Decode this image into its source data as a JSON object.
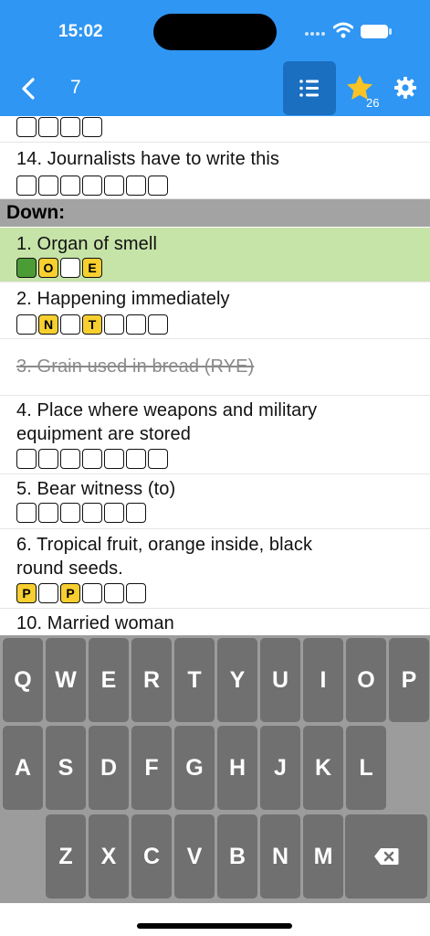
{
  "status_bar": {
    "time": "15:02"
  },
  "header": {
    "level": "7",
    "star_count": "26",
    "icons": {
      "back": "chevron-left-icon",
      "list": "list-icon",
      "star": "star-icon",
      "settings": "gear-icon"
    },
    "colors": {
      "bar": "#2f96f3",
      "list_active": "#1b6fc0",
      "star": "#f7c325"
    }
  },
  "clues": {
    "top_partial": {
      "cells": [
        {
          "l": "",
          "s": ""
        },
        {
          "l": "",
          "s": ""
        },
        {
          "l": "",
          "s": ""
        },
        {
          "l": "",
          "s": ""
        }
      ]
    },
    "across_14": {
      "text": "14. Journalists have to write this",
      "cells": [
        {
          "l": "",
          "s": ""
        },
        {
          "l": "",
          "s": ""
        },
        {
          "l": "",
          "s": ""
        },
        {
          "l": "",
          "s": ""
        },
        {
          "l": "",
          "s": ""
        },
        {
          "l": "",
          "s": ""
        },
        {
          "l": "",
          "s": ""
        }
      ]
    },
    "down_header": "Down:",
    "down": [
      {
        "text": "1. Organ of smell",
        "cells": [
          {
            "l": "",
            "s": "g"
          },
          {
            "l": "O",
            "s": "y"
          },
          {
            "l": "",
            "s": ""
          },
          {
            "l": "E",
            "s": "y"
          }
        ]
      },
      {
        "text": "2. Happening immediately",
        "cells": [
          {
            "l": "",
            "s": ""
          },
          {
            "l": "N",
            "s": "y"
          },
          {
            "l": "",
            "s": ""
          },
          {
            "l": "T",
            "s": "y"
          },
          {
            "l": "",
            "s": ""
          },
          {
            "l": "",
            "s": ""
          },
          {
            "l": "",
            "s": ""
          }
        ]
      },
      {
        "text": "3. Grain used in bread (RYE)",
        "cells": []
      },
      {
        "text_line1": "4. Place where weapons and military",
        "text_line2": "equipment are stored",
        "cells": [
          {
            "l": "",
            "s": ""
          },
          {
            "l": "",
            "s": ""
          },
          {
            "l": "",
            "s": ""
          },
          {
            "l": "",
            "s": ""
          },
          {
            "l": "",
            "s": ""
          },
          {
            "l": "",
            "s": ""
          },
          {
            "l": "",
            "s": ""
          }
        ]
      },
      {
        "text": "5. Bear witness (to)",
        "cells": [
          {
            "l": "",
            "s": ""
          },
          {
            "l": "",
            "s": ""
          },
          {
            "l": "",
            "s": ""
          },
          {
            "l": "",
            "s": ""
          },
          {
            "l": "",
            "s": ""
          },
          {
            "l": "",
            "s": ""
          }
        ]
      },
      {
        "text_line1": "6. Tropical fruit, orange inside, black",
        "text_line2": "round seeds.",
        "cells": [
          {
            "l": "P",
            "s": "y"
          },
          {
            "l": "",
            "s": ""
          },
          {
            "l": "P",
            "s": "y"
          },
          {
            "l": "",
            "s": ""
          },
          {
            "l": "",
            "s": ""
          },
          {
            "l": "",
            "s": ""
          }
        ]
      },
      {
        "text": "10. Married woman",
        "cells": []
      }
    ],
    "colors": {
      "present": "#f7cf2f",
      "correct": "#4c9c36",
      "selected_row": "#c6e3a8",
      "section_header": "#a3a3a3"
    }
  },
  "keyboard": {
    "row1": [
      "Q",
      "W",
      "E",
      "R",
      "T",
      "Y",
      "U",
      "I",
      "O",
      "P"
    ],
    "row2": [
      "A",
      "S",
      "D",
      "F",
      "G",
      "H",
      "J",
      "K",
      "L"
    ],
    "row3": [
      "Z",
      "X",
      "C",
      "V",
      "B",
      "N",
      "M"
    ],
    "backspace_icon": "backspace-icon"
  }
}
